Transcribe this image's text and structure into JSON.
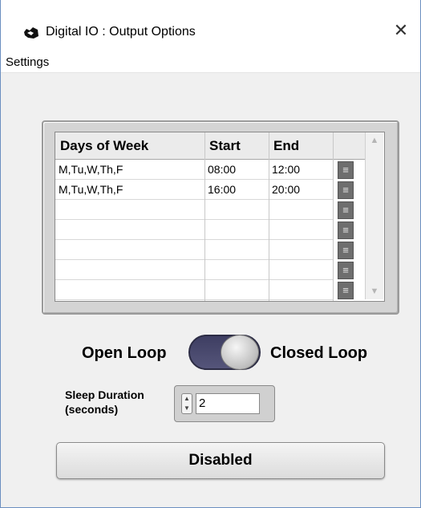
{
  "window": {
    "title": "Digital IO : Output Options",
    "close_glyph": "✕",
    "icon": "app-icon"
  },
  "menu": {
    "settings": "Settings"
  },
  "table": {
    "headers": [
      "Days of Week",
      "Start",
      "End"
    ],
    "rows": [
      [
        "M,Tu,W,Th,F",
        "08:00",
        "12:00"
      ],
      [
        "M,Tu,W,Th,F",
        "16:00",
        "20:00"
      ],
      [
        "",
        "",
        ""
      ],
      [
        "",
        "",
        ""
      ],
      [
        "",
        "",
        ""
      ],
      [
        "",
        "",
        ""
      ],
      [
        "",
        "",
        ""
      ]
    ],
    "row_button_glyph": "≡",
    "scroll_up": "▲",
    "scroll_down": "▼"
  },
  "loop": {
    "open_label": "Open Loop",
    "closed_label": "Closed Loop",
    "state": "closed"
  },
  "sleep": {
    "label_line1": "Sleep Duration",
    "label_line2": "(seconds)",
    "value": "2",
    "up": "▲",
    "down": "▼"
  },
  "status_button": {
    "label": "Disabled"
  },
  "colors": {
    "toggle_track": "#4a4a6e",
    "row_button": "#6e6e6e",
    "panel": "#d4d4d4"
  }
}
